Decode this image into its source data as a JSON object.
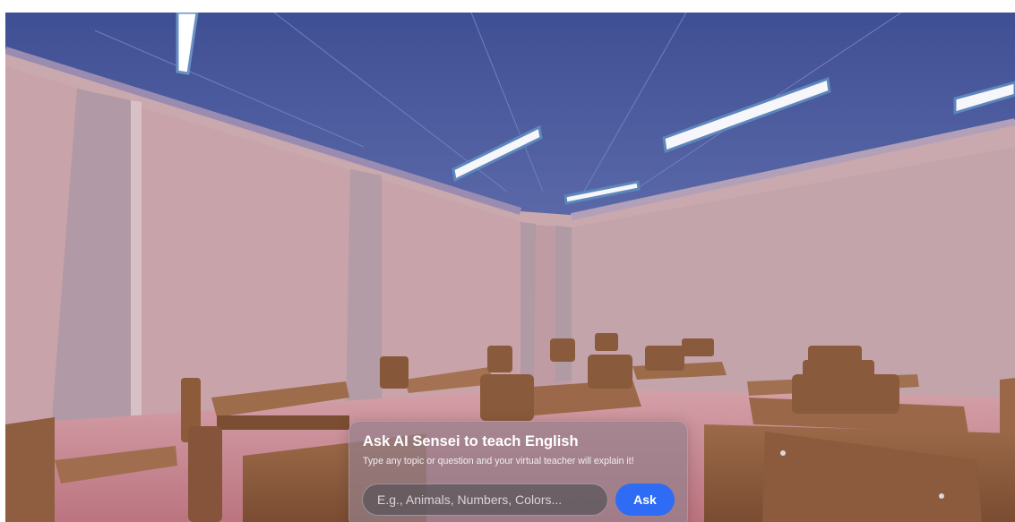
{
  "ask_panel": {
    "title": "Ask AI Sensei to teach English",
    "subtitle": "Type any topic or question and your virtual teacher will explain it!",
    "input_value": "",
    "input_placeholder": "E.g., Animals, Numbers, Colors...",
    "button_label": "Ask"
  },
  "colors": {
    "ceiling": "#4b5a9c",
    "wall": "#c8a7ad",
    "floor": "#c98791",
    "desk_wood": "#8a5a3c",
    "accent": "#2e6cf5"
  }
}
